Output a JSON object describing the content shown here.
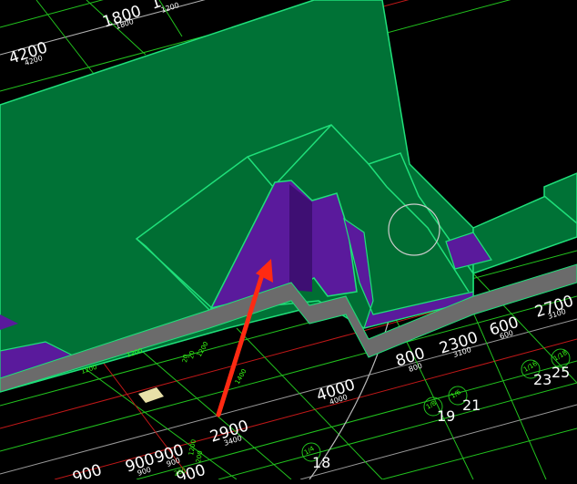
{
  "viewport": {
    "name": "3d-cad-model-view"
  },
  "dimensions": {
    "top_left_1": {
      "big": "4200",
      "small": "4200"
    },
    "top_left_2": {
      "big": "1800",
      "small": "1800"
    },
    "top_left_3": {
      "big": "1",
      "small": "1200"
    },
    "d_800": {
      "big": "800",
      "small": "800"
    },
    "d_2300": {
      "big": "2300",
      "small": "3100"
    },
    "d_600": {
      "big": "600",
      "small": "600"
    },
    "d_2700": {
      "big": "2700",
      "small": "3100"
    },
    "d_4000": {
      "big": "4000",
      "small": "4000"
    },
    "d_2900": {
      "big": "2900",
      "small": "3400"
    },
    "d_900a": {
      "big": "900",
      "small": "900"
    },
    "d_900b": {
      "big": "900",
      "small": "900"
    },
    "d_bottom_left": {
      "big": "900"
    },
    "d_bottom_mid": {
      "big": "900"
    }
  },
  "small_green_dims": [
    "1200",
    "1200",
    "1200",
    "20",
    "20",
    "1400",
    "1200",
    "200",
    "200"
  ],
  "axis_labels": [
    "18",
    "19",
    "21",
    "23",
    "25"
  ],
  "axis_bubble_labels": [
    "1/4",
    "1/8",
    "1/6",
    "1/16",
    "1/18"
  ],
  "colors": {
    "background": "#000000",
    "roof_fill": "#007236",
    "roof_edge": "#1fe07a",
    "wall_purple": "#5a1a9c",
    "wall_purple_dark": "#3e0f73",
    "slab_gray": "#6b6b6b",
    "arrow_red": "#ff2a12",
    "grid_green": "#22c21e",
    "grid_red": "#c01818"
  }
}
